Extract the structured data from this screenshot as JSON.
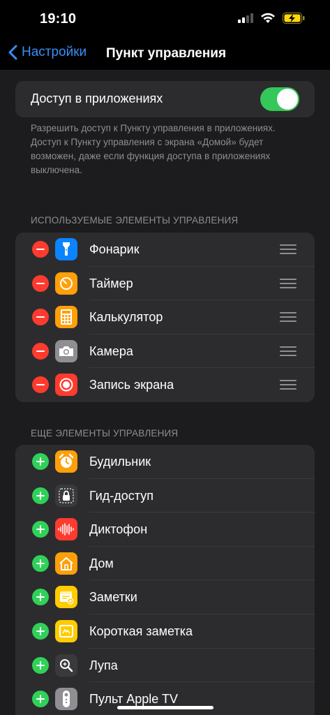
{
  "status": {
    "time": "19:10"
  },
  "nav": {
    "back_label": "Настройки",
    "title": "Пункт управления"
  },
  "access": {
    "label": "Доступ в приложениях",
    "enabled": true,
    "footnote": "Разрешить доступ к Пункту управления в приложениях. Доступ к Пункту управления с экрана «Домой» будет возможен, даже если функция доступа в приложениях выключена."
  },
  "included": {
    "header": "ИСПОЛЬЗУЕМЫЕ ЭЛЕМЕНТЫ УПРАВЛЕНИЯ",
    "items": [
      {
        "label": "Фонарик",
        "icon": "flashlight-icon",
        "color": "#0a84ff"
      },
      {
        "label": "Таймер",
        "icon": "timer-icon",
        "color": "#ff9f0a"
      },
      {
        "label": "Калькулятор",
        "icon": "calculator-icon",
        "color": "#ff9f0a"
      },
      {
        "label": "Камера",
        "icon": "camera-icon",
        "color": "#8e8e93"
      },
      {
        "label": "Запись экрана",
        "icon": "screen-recording-icon",
        "color": "#ff3b30"
      }
    ]
  },
  "more": {
    "header": "ЕЩЕ ЭЛЕМЕНТЫ УПРАВЛЕНИЯ",
    "items": [
      {
        "label": "Будильник",
        "icon": "alarm-icon",
        "color": "#ff9f0a"
      },
      {
        "label": "Гид-доступ",
        "icon": "guided-access-icon",
        "color": "#3a3a3c"
      },
      {
        "label": "Диктофон",
        "icon": "voice-memos-icon",
        "color": "#ff3b30"
      },
      {
        "label": "Дом",
        "icon": "home-icon",
        "color": "#ff9f0a"
      },
      {
        "label": "Заметки",
        "icon": "notes-icon",
        "color": "#ffcc00"
      },
      {
        "label": "Короткая заметка",
        "icon": "quick-note-icon",
        "color": "#ffcc00"
      },
      {
        "label": "Лупа",
        "icon": "magnifier-icon",
        "color": "#3a3a3c"
      },
      {
        "label": "Пульт Apple TV",
        "icon": "apple-tv-remote-icon",
        "color": "#8e8e93"
      }
    ]
  }
}
